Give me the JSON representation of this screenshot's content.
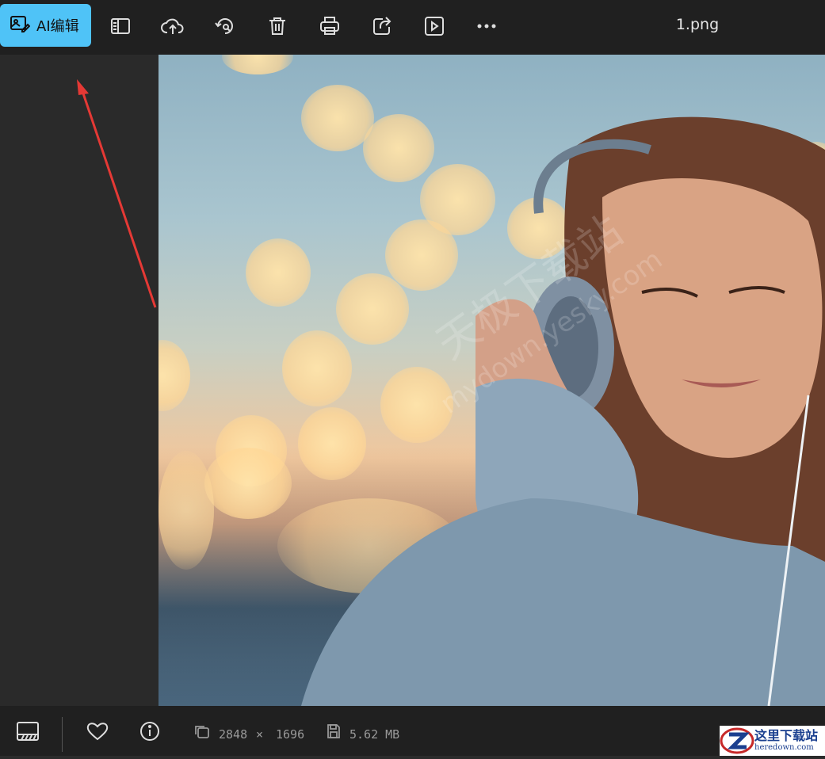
{
  "toolbar": {
    "ai_edit_label": "AI编辑",
    "icons": [
      "image-edit-icon",
      "sidebar-toggle-icon",
      "cloud-upload-icon",
      "rotate-icon",
      "trash-icon",
      "print-icon",
      "share-icon",
      "slideshow-icon",
      "more-icon"
    ],
    "filename": "1.png"
  },
  "photo": {
    "watermark_line1": "天极下载站",
    "watermark_line2": "mydown.yesky.com"
  },
  "statusbar": {
    "dimensions_width": "2848",
    "dimensions_sep": "×",
    "dimensions_height": "1696",
    "file_size": "5.62 MB"
  },
  "logo": {
    "name": "这里下载站",
    "url": "heredown.com"
  },
  "colors": {
    "accent": "#4fc3f7",
    "toolbar_bg": "#202020",
    "arrow": "#e53935"
  }
}
